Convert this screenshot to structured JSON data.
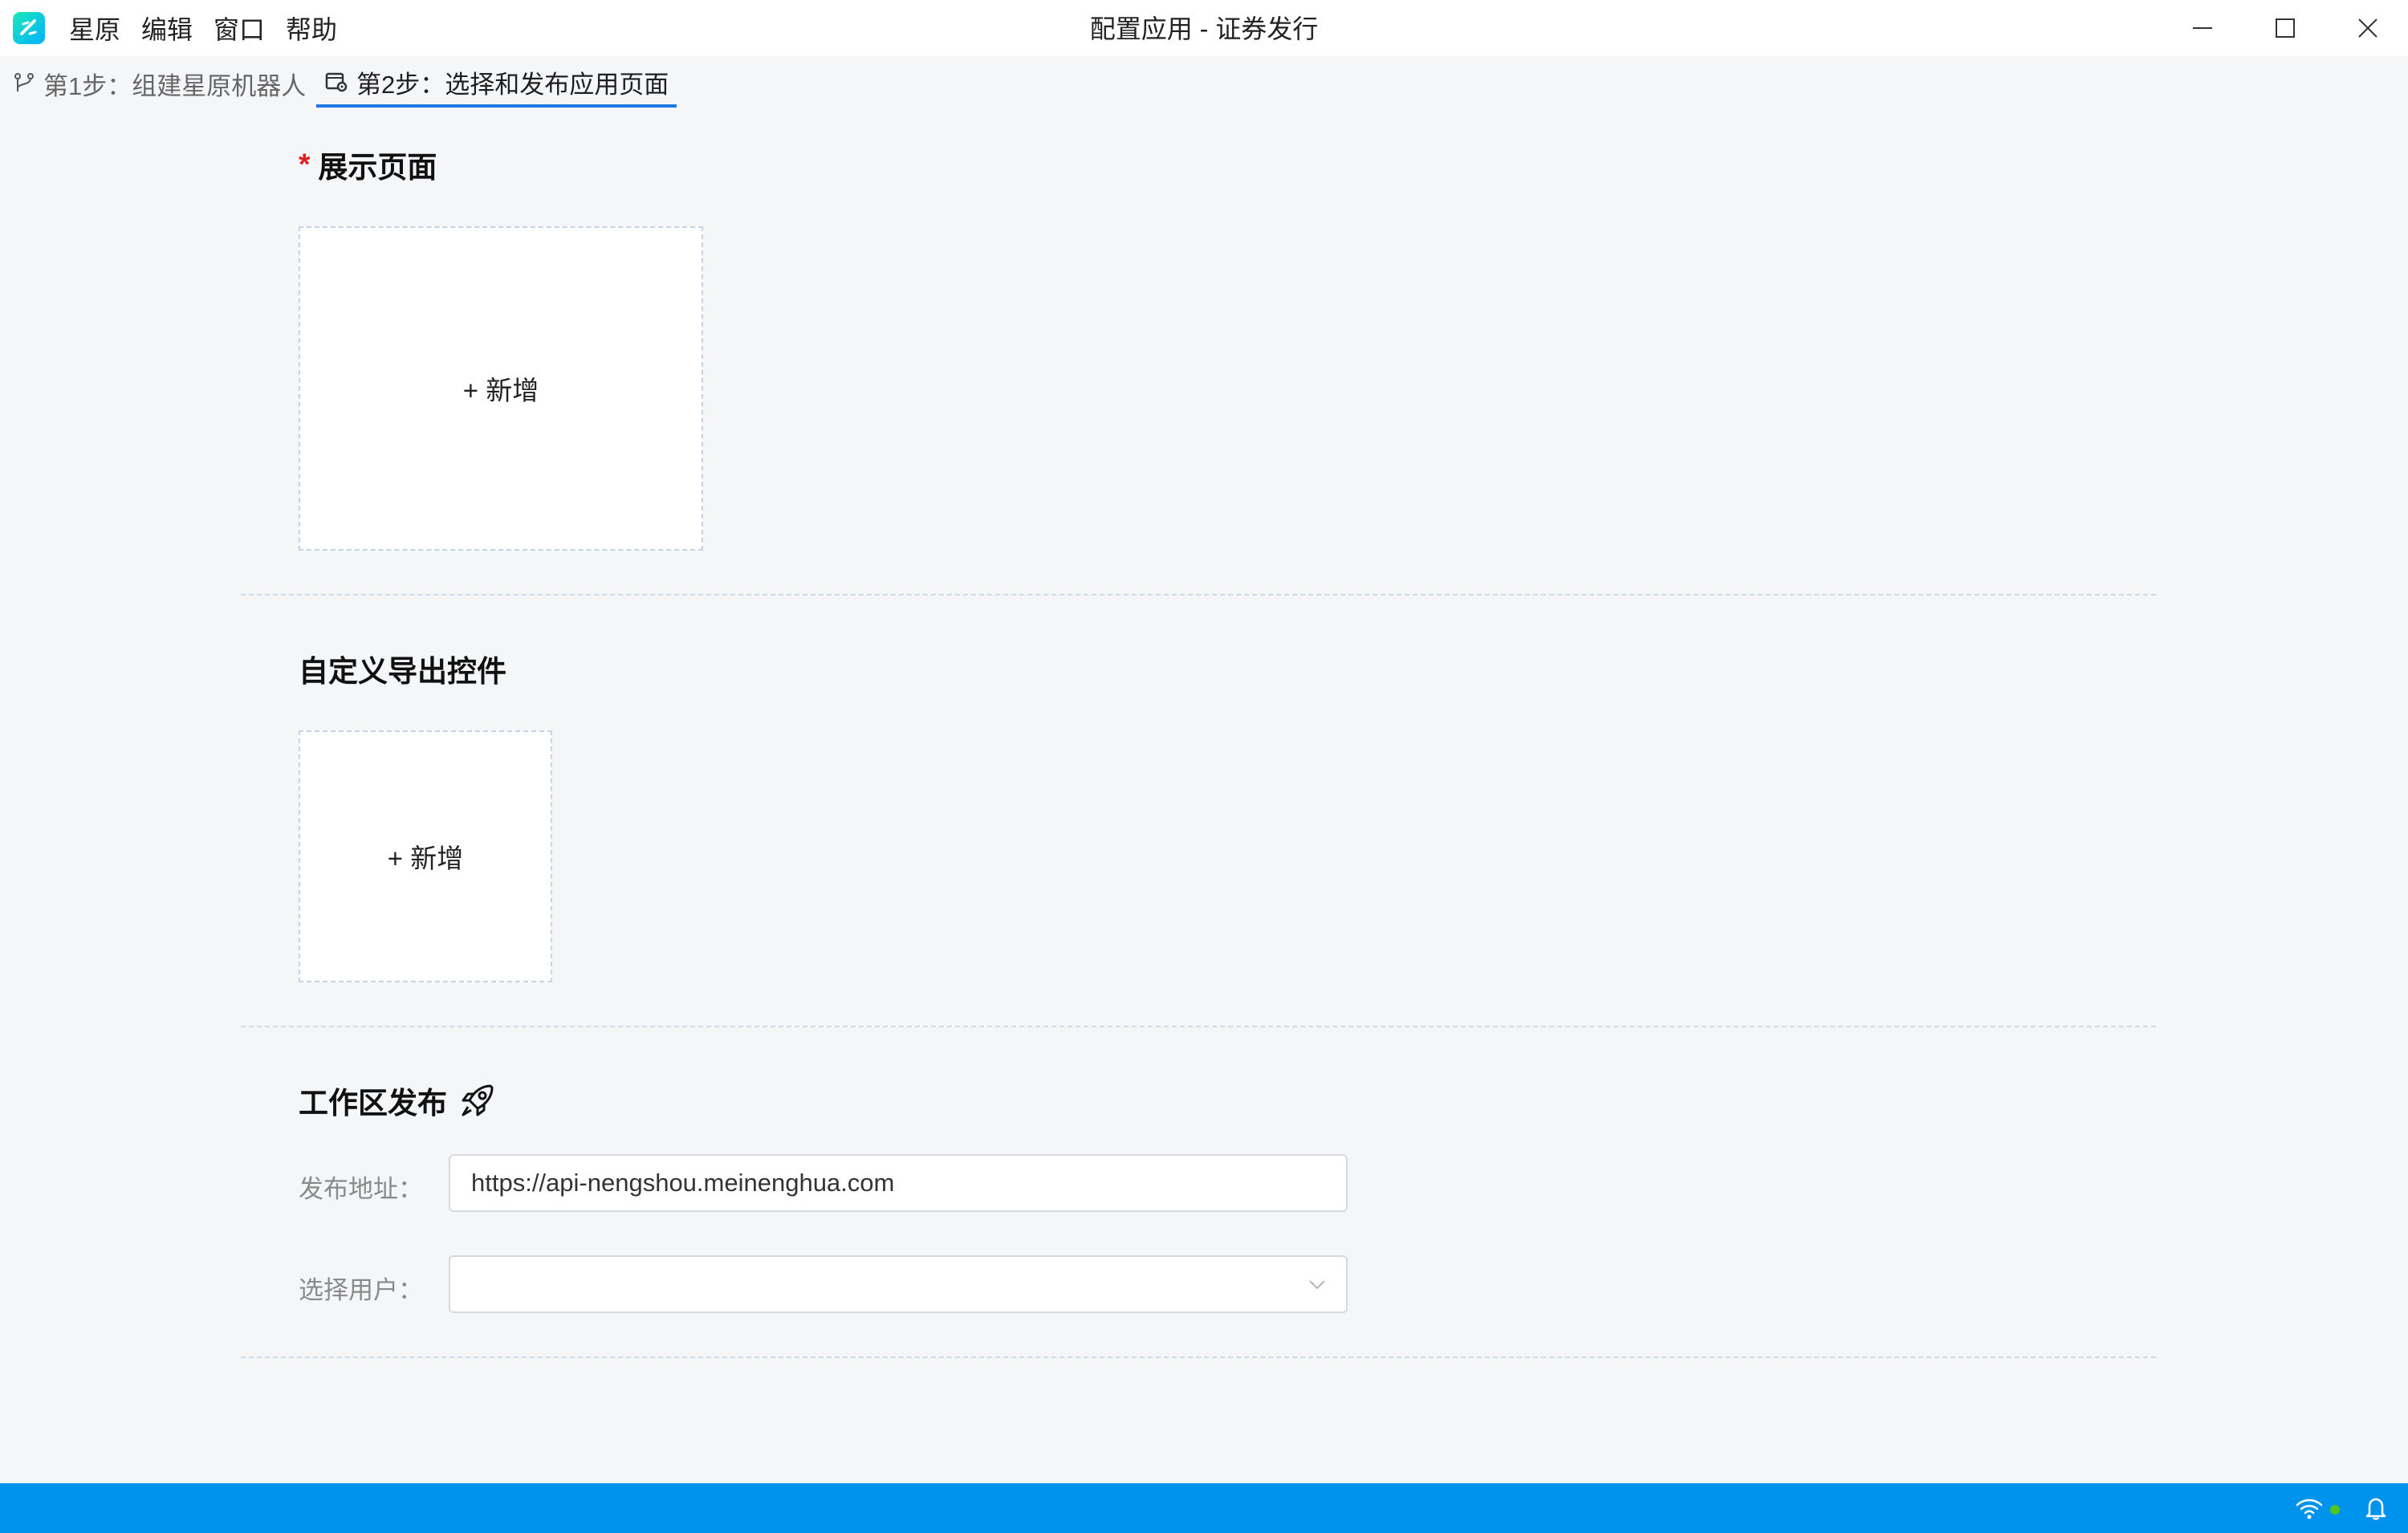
{
  "app": {
    "window_title": "配置应用 - 证券发行",
    "menu": [
      "星原",
      "编辑",
      "窗口",
      "帮助"
    ]
  },
  "tabs": [
    {
      "label": "第1步：组建星原机器人",
      "icon": "branch-icon",
      "active": false
    },
    {
      "label": "第2步：选择和发布应用页面",
      "icon": "page-settings-icon",
      "active": true
    }
  ],
  "sections": {
    "display_page": {
      "required_mark": "*",
      "title": "展示页面",
      "add_label": "+ 新增"
    },
    "custom_export": {
      "title": "自定义导出控件",
      "add_label": "+ 新增"
    },
    "workspace_publish": {
      "title": "工作区发布",
      "icon": "rocket-icon",
      "address_label": "发布地址：",
      "address_value": "https://api-nengshou.meinenghua.com",
      "user_label": "选择用户：",
      "user_value": ""
    }
  },
  "statusbar": {
    "color": "#0093ee",
    "icons": [
      "wifi-icon",
      "bell-icon"
    ],
    "connection_dot_color": "#52c41a"
  }
}
